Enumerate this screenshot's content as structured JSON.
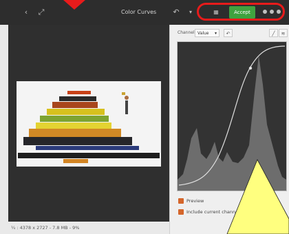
{
  "header": {
    "title": "Color Curves",
    "accept_label": "Accept",
    "icons": [
      "back-icon",
      "fullscreen-icon",
      "undo-icon",
      "dropdown-icon",
      "grid-icon",
      "menu-dots-icon"
    ]
  },
  "panel": {
    "channel_label": "Channel",
    "channel_value": "Value",
    "channel_options": [
      "Value"
    ],
    "options": {
      "preview_label": "Preview",
      "include_label": "Include current channel"
    }
  },
  "status": {
    "text": "¼ : 4378 x 2727 - 7.8 MB - 9%"
  },
  "colors": {
    "accent": "#3fa23f",
    "highlight_ring": "#e81b1b",
    "pointer": "#ffff7f",
    "checkbox": "#d5662b"
  }
}
